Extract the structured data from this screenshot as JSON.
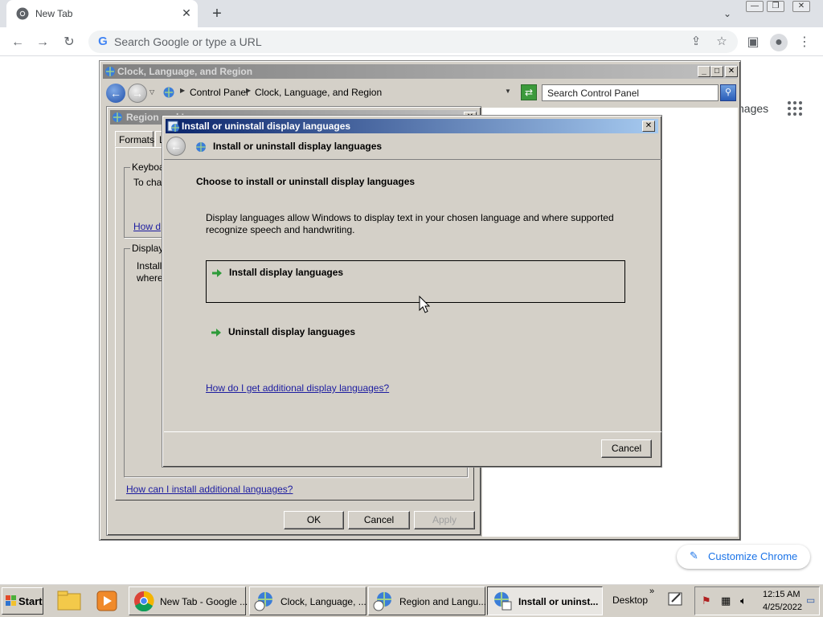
{
  "browser": {
    "tab_title": "New Tab",
    "omnibox_placeholder": "Search Google or type a URL",
    "ntp_apps_label": "nages",
    "customize_label": "Customize Chrome"
  },
  "control_panel": {
    "title": "Clock, Language, and Region",
    "breadcrumb": [
      "Control Panel",
      "Clock, Language, and Region"
    ],
    "search_placeholder": "Search Control Panel"
  },
  "region_window": {
    "title": "Region and Languages",
    "tabs": [
      "Formats",
      "L"
    ],
    "keyboard_group": {
      "label": "Keyboa",
      "text": "To cha",
      "link": "How d"
    },
    "display_group": {
      "label": "Display",
      "text_line1": "Install",
      "text_line2": "where"
    },
    "help_link": "How can I install additional languages?",
    "buttons": {
      "ok": "OK",
      "cancel": "Cancel",
      "apply": "Apply"
    }
  },
  "dialog": {
    "title": "Install or uninstall display languages",
    "header_title": "Install or uninstall display languages",
    "heading": "Choose to install or uninstall display languages",
    "description": "Display languages allow Windows to display text in your chosen language and where supported recognize speech and handwriting.",
    "tasks": [
      {
        "label": "Install display languages"
      },
      {
        "label": "Uninstall display languages"
      }
    ],
    "help_link": "How do I get additional display languages?",
    "cancel_label": "Cancel"
  },
  "taskbar": {
    "start_label": "Start",
    "items": [
      {
        "label": "New Tab - Google ..."
      },
      {
        "label": "Clock, Language, ..."
      },
      {
        "label": "Region and Langu..."
      },
      {
        "label": "Install or uninst..."
      }
    ],
    "desktop_label": "Desktop",
    "time": "12:15 AM",
    "date": "4/25/2022"
  },
  "colors": {
    "accent_link": "#1c1ca0",
    "chrome_blue": "#1a73e8",
    "dialog_face": "#d4d0c8",
    "task_arrow": "#2e9b3a"
  }
}
